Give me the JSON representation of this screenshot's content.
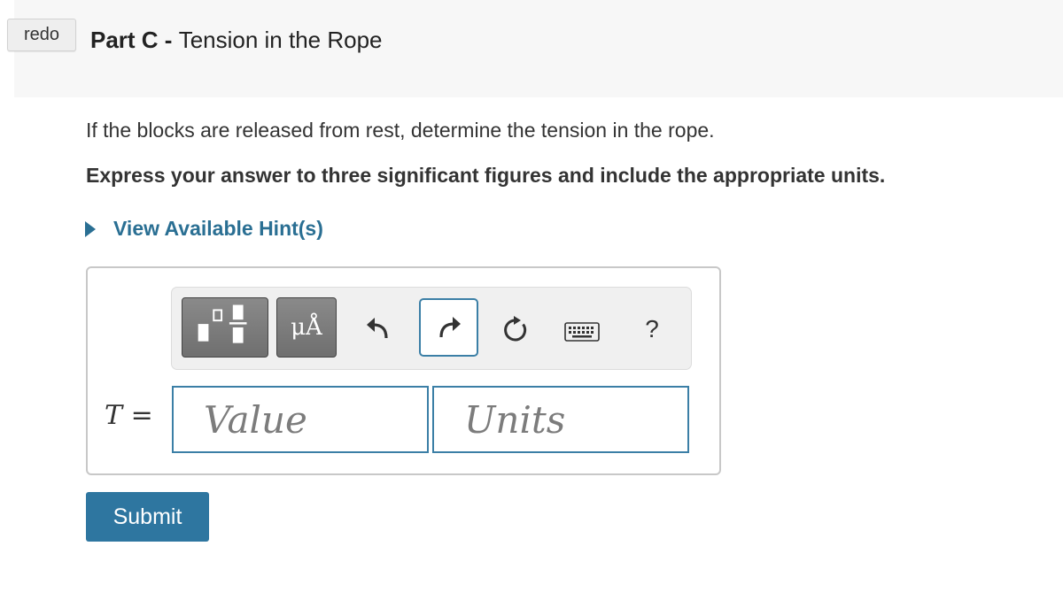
{
  "header": {
    "redo_label": "redo",
    "part_label": "Part C",
    "separator": " - ",
    "part_title": "Tension in the Rope"
  },
  "problem": {
    "question": "If the blocks are released from rest, determine the tension in the rope.",
    "instruction": "Express your answer to three significant figures and include the appropriate units."
  },
  "hints": {
    "label": "View Available Hint(s)"
  },
  "toolbar": {
    "symbols_label": "μÅ",
    "help_label": "?",
    "icons": [
      "templates-icon",
      "symbols-icon",
      "undo-icon",
      "redo-icon",
      "reset-icon",
      "keyboard-icon",
      "help-icon"
    ]
  },
  "answer": {
    "variable": "T",
    "equals": "=",
    "value_placeholder": "Value",
    "units_placeholder": "Units"
  },
  "submit": {
    "label": "Submit"
  },
  "colors": {
    "accent": "#2e76a0",
    "link": "#2a6f93",
    "field_border": "#3b7fa6"
  }
}
